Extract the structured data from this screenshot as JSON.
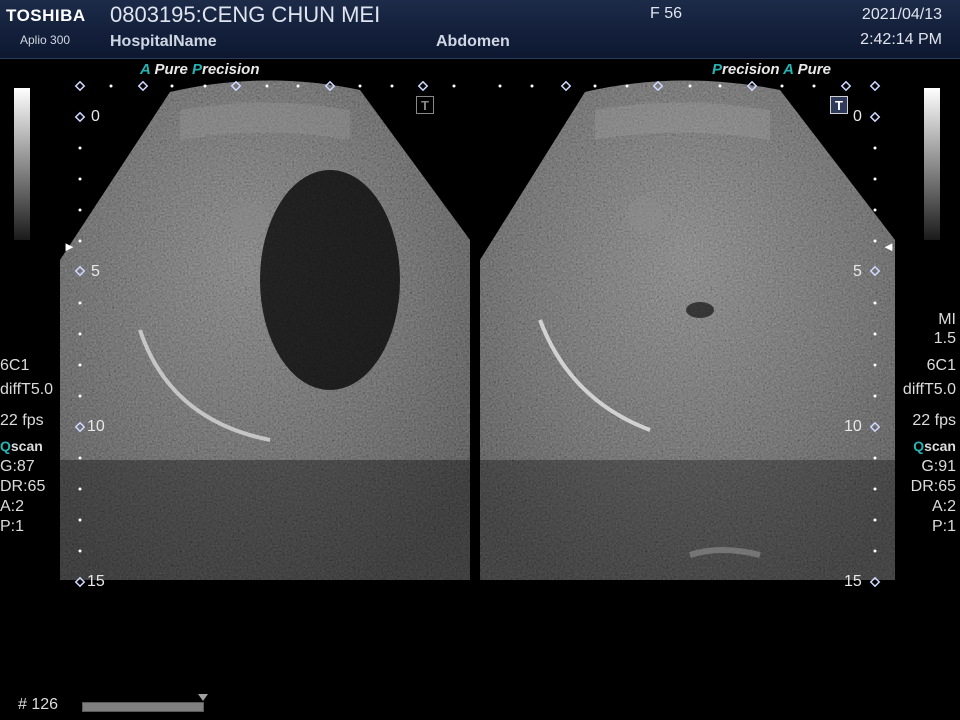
{
  "header": {
    "brand": "TOSHIBA",
    "model": "Aplio 300",
    "patient": "0803195:CENG CHUN MEI",
    "hospital": "HospitalName",
    "exam": "Abdomen",
    "sex_age": "F  56",
    "date": "2021/04/13",
    "time": "2:42:14 PM"
  },
  "logos": {
    "left": {
      "a": "A",
      "pure": " Pure ",
      "p": "P",
      "precision": "recision"
    },
    "right": {
      "p": "P",
      "precision": "recision ",
      "a": "A",
      "pure": " Pure"
    }
  },
  "depth_scale": {
    "left": [
      "0",
      "5",
      "10",
      "15"
    ],
    "right": [
      "0",
      "5",
      "10",
      "15"
    ],
    "focus_marker": "►"
  },
  "left_params": {
    "probe": "6C1",
    "mode": "diffT5.0",
    "fps": "22 fps",
    "qscan_q": "Q",
    "qscan_rest": "scan",
    "gain": "G:87",
    "dr": "DR:65",
    "a": "A:2",
    "p": "P:1"
  },
  "right_params": {
    "mi_label": "MI",
    "mi_value": "1.5",
    "probe": "6C1",
    "mode": "diffT5.0",
    "fps": "22 fps",
    "qscan_q": "Q",
    "qscan_rest": "scan",
    "gain": "G:91",
    "dr": "DR:65",
    "a": "A:2",
    "p": "P:1"
  },
  "t_marks": {
    "left": "T",
    "right": "T"
  },
  "cine": {
    "frame": "# 126",
    "position": 1.0
  }
}
